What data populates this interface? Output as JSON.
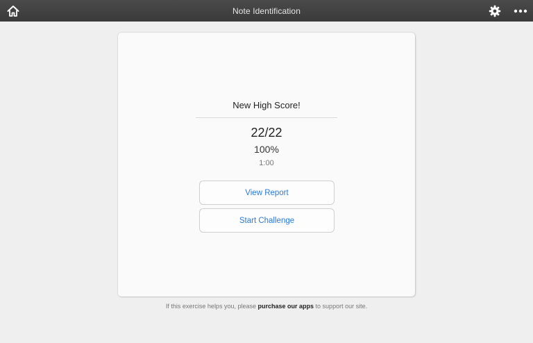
{
  "topbar": {
    "title": "Note Identification",
    "home_icon": "home-icon",
    "settings_icon": "gear-icon",
    "more_icon": "more-icon"
  },
  "result": {
    "heading": "New High Score!",
    "score": "22/22",
    "percent": "100%",
    "time": "1:00"
  },
  "buttons": {
    "view_report": "View Report",
    "start_challenge": "Start Challenge"
  },
  "footer": {
    "prefix": "If this exercise helps you, please",
    "link": "purchase our apps",
    "suffix": "to support our site."
  },
  "colors": {
    "topbar": "#3f3f3f",
    "accent": "#2a7ad4",
    "background": "#efefef"
  }
}
